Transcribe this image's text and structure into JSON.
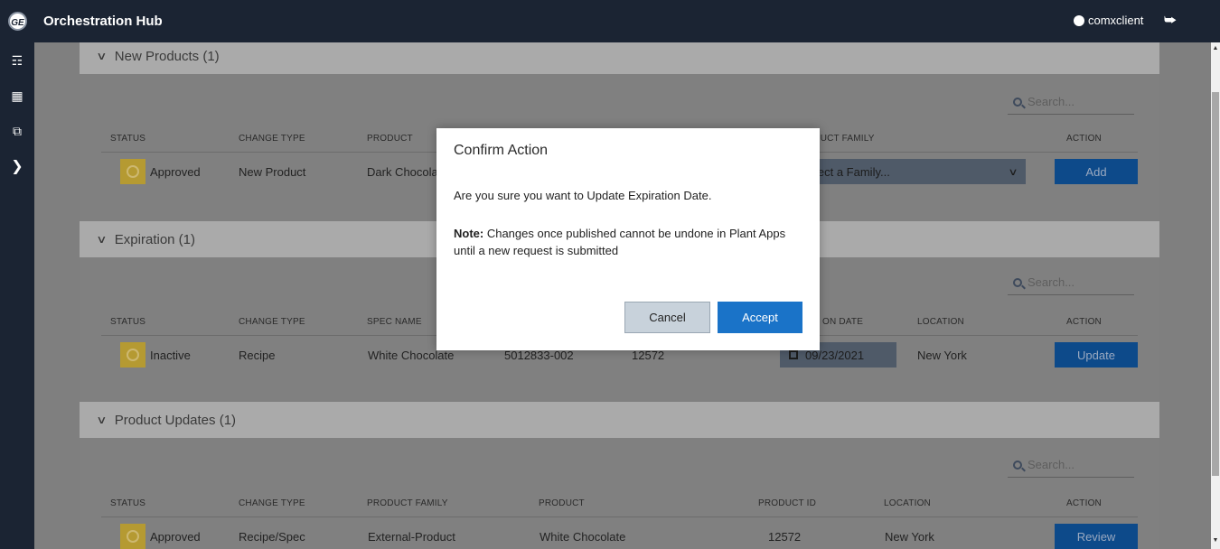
{
  "app": {
    "logo_text": "GE",
    "title": "Orchestration Hub",
    "user": "comxclient"
  },
  "sidenav": {
    "icons": [
      "hierarchy-icon",
      "factory-icon",
      "transfer-icon",
      "expand-icon"
    ]
  },
  "sections": {
    "new_products": {
      "header": "New Products (1)",
      "search_placeholder": "Search...",
      "columns": {
        "status": "STATUS",
        "change_type": "CHANGE TYPE",
        "product": "PRODUCT",
        "product_family": "PRODUCT FAMILY",
        "action": "ACTION"
      },
      "row": {
        "status": "Approved",
        "change_type": "New Product",
        "product": "Dark Chocola",
        "family_dropdown": "lect a Family...",
        "action": "Add"
      }
    },
    "expiration": {
      "header": "Expiration (1)",
      "search_placeholder": "Search...",
      "columns": {
        "status": "STATUS",
        "change_type": "CHANGE TYPE",
        "spec_name": "SPEC NAME",
        "expiration_date": "ON DATE",
        "location": "LOCATION",
        "action": "ACTION"
      },
      "row": {
        "status": "Inactive",
        "change_type": "Recipe",
        "spec_name": "White Chocolate",
        "code": "5012833-002",
        "product_id": "12572",
        "date": "09/23/2021",
        "location": "New York",
        "action": "Update"
      }
    },
    "product_updates": {
      "header": "Product Updates (1)",
      "search_placeholder": "Search...",
      "columns": {
        "status": "STATUS",
        "change_type": "CHANGE TYPE",
        "product_family": "PRODUCT FAMILY",
        "product": "PRODUCT",
        "product_id": "PRODUCT ID",
        "location": "LOCATION",
        "action": "ACTION"
      },
      "row": {
        "status": "Approved",
        "change_type": "Recipe/Spec",
        "product_family": "External-Product",
        "product": "White Chocolate",
        "product_id": "12572",
        "location": "New York",
        "action": "Review"
      }
    }
  },
  "modal": {
    "title": "Confirm Action",
    "message": "Are you sure you want to Update Expiration Date.",
    "note_label": "Note:",
    "note_text": " Changes once published cannot be undone in Plant Apps until a new request is submitted",
    "cancel": "Cancel",
    "accept": "Accept"
  },
  "colors": {
    "topbar": "#1b2433",
    "accent": "#1a73c8",
    "status_badge": "#f0c33c"
  }
}
